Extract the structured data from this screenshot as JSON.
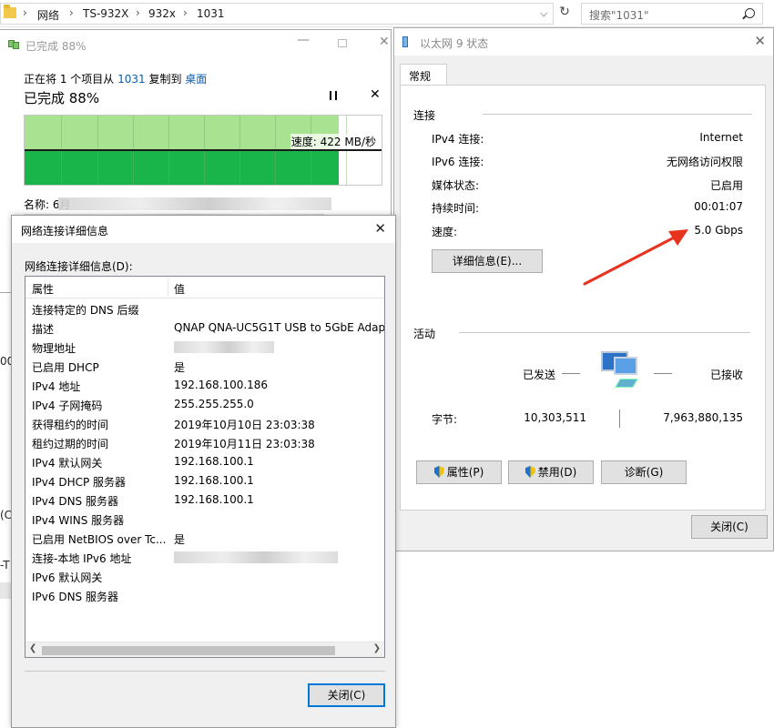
{
  "explorer": {
    "breadcrumbs": [
      "网络",
      "TS-932X",
      "932x",
      "1031"
    ],
    "search_placeholder": "搜索\"1031\""
  },
  "copy_window": {
    "title": "已完成 88%",
    "line_prefix": "正在将 ",
    "count": "1",
    "line_mid": " 个项目从 ",
    "source": "1031",
    "line_mid2": " 复制到 ",
    "dest": "桌面",
    "progress_label": "已完成 88%",
    "progress_percent": 88,
    "speed": "速度: 422 MB/秒",
    "name_label": "名称: 6月"
  },
  "left_fragments": [
    "00",
    "(C:",
    "-T"
  ],
  "ethernet_status": {
    "title": "以太网 9 状态",
    "tab": "常规",
    "connection_group": "连接",
    "rows": [
      {
        "k": "IPv4 连接:",
        "v": "Internet"
      },
      {
        "k": "IPv6 连接:",
        "v": "无网络访问权限"
      },
      {
        "k": "媒体状态:",
        "v": "已启用"
      },
      {
        "k": "持续时间:",
        "v": "00:01:07"
      },
      {
        "k": "速度:",
        "v": "5.0 Gbps"
      }
    ],
    "details_button": "详细信息(E)...",
    "activity_group": "活动",
    "sent_label": "已发送",
    "received_label": "已接收",
    "bytes_label": "字节:",
    "bytes_sent": "10,303,511",
    "bytes_received": "7,963,880,135",
    "properties_button": "属性(P)",
    "disable_button": "禁用(D)",
    "diagnose_button": "诊断(G)",
    "close_button": "关闭(C)"
  },
  "details_dialog": {
    "title": "网络连接详细信息",
    "label": "网络连接详细信息(D):",
    "col_property": "属性",
    "col_value": "值",
    "rows": [
      {
        "k": "连接特定的 DNS 后缀",
        "v": ""
      },
      {
        "k": "描述",
        "v": "QNAP QNA-UC5G1T USB to 5GbE Adap"
      },
      {
        "k": "物理地址",
        "v": ""
      },
      {
        "k": "已启用 DHCP",
        "v": "是"
      },
      {
        "k": "IPv4 地址",
        "v": "192.168.100.186"
      },
      {
        "k": "IPv4 子网掩码",
        "v": "255.255.255.0"
      },
      {
        "k": "获得租约的时间",
        "v": "2019年10月10日 23:03:38"
      },
      {
        "k": "租约过期的时间",
        "v": "2019年10月11日 23:03:38"
      },
      {
        "k": "IPv4 默认网关",
        "v": "192.168.100.1"
      },
      {
        "k": "IPv4 DHCP 服务器",
        "v": "192.168.100.1"
      },
      {
        "k": "IPv4 DNS 服务器",
        "v": "192.168.100.1"
      },
      {
        "k": "IPv4 WINS 服务器",
        "v": ""
      },
      {
        "k": "已启用 NetBIOS over Tc...",
        "v": "是"
      },
      {
        "k": "连接-本地 IPv6 地址",
        "v": ""
      },
      {
        "k": "IPv6 默认网关",
        "v": ""
      },
      {
        "k": "IPv6 DNS 服务器",
        "v": ""
      }
    ],
    "close_button": "关闭(C)"
  },
  "colors": {
    "graph_upper": "#a8e391",
    "graph_lower": "#19b54a",
    "link": "#0b5fb0",
    "arrow": "#e8321e",
    "default_button_border": "#0078d7"
  }
}
